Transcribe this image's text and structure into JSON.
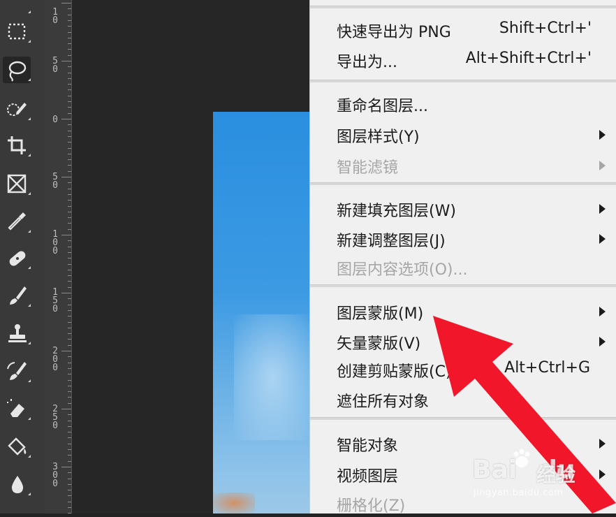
{
  "ruler": {
    "marks": [
      {
        "top": "1",
        "digits": [
          "0"
        ]
      },
      {
        "top": "5",
        "digits": [
          "0"
        ]
      },
      {
        "top": "0",
        "digits": []
      },
      {
        "top": "5",
        "digits": [
          "0"
        ]
      },
      {
        "top": "1",
        "digits": [
          "0",
          "0"
        ]
      },
      {
        "top": "1",
        "digits": [
          "5",
          "0"
        ]
      },
      {
        "top": "2",
        "digits": [
          "0",
          "0"
        ]
      },
      {
        "top": "2",
        "digits": [
          "5",
          "0"
        ]
      },
      {
        "top": "3",
        "digits": [
          "0",
          "0"
        ]
      }
    ]
  },
  "tools": [
    {
      "name": "move-tool",
      "icon": "move-icon"
    },
    {
      "name": "marquee-tool",
      "icon": "marquee-icon"
    },
    {
      "name": "lasso-tool",
      "icon": "lasso-icon",
      "active": true
    },
    {
      "name": "quick-selection-tool",
      "icon": "quick-selection-icon"
    },
    {
      "name": "crop-tool",
      "icon": "crop-icon"
    },
    {
      "name": "frame-tool",
      "icon": "frame-icon"
    },
    {
      "name": "eyedropper-tool",
      "icon": "eyedropper-icon"
    },
    {
      "name": "healing-tool",
      "icon": "bandage-icon"
    },
    {
      "name": "brush-tool",
      "icon": "brush-icon"
    },
    {
      "name": "stamp-tool",
      "icon": "stamp-icon"
    },
    {
      "name": "history-brush-tool",
      "icon": "history-brush-icon"
    },
    {
      "name": "eraser-tool",
      "icon": "eraser-icon"
    },
    {
      "name": "paint-bucket-tool",
      "icon": "paint-bucket-icon"
    },
    {
      "name": "blur-tool",
      "icon": "drop-icon"
    }
  ],
  "menu": {
    "items": [
      {
        "label": "快速导出为 PNG",
        "shortcut": "Shift+Ctrl+'"
      },
      {
        "label": "导出为...",
        "shortcut": "Alt+Shift+Ctrl+'"
      },
      {
        "label": "重命名图层..."
      },
      {
        "label": "图层样式(Y)",
        "submenu": true
      },
      {
        "label": "智能滤镜",
        "submenu": true,
        "disabled": true
      },
      {
        "label": "新建填充图层(W)",
        "submenu": true
      },
      {
        "label": "新建调整图层(J)",
        "submenu": true
      },
      {
        "label": "图层内容选项(O)...",
        "disabled": true
      },
      {
        "label": "图层蒙版(M)",
        "submenu": true
      },
      {
        "label": "矢量蒙版(V)",
        "submenu": true
      },
      {
        "label": "创建剪贴蒙版(C)",
        "shortcut": "Alt+Ctrl+G"
      },
      {
        "label": "遮住所有对象"
      },
      {
        "label": "智能对象",
        "submenu": true
      },
      {
        "label": "视频图层",
        "submenu": true
      },
      {
        "label": "栅格化(Z)",
        "submenu": true,
        "disabled": true
      }
    ]
  },
  "annotation": {
    "color": "#f2162a"
  },
  "watermark": {
    "logo_left": "Bai",
    "logo_right": "du",
    "sub": "经验",
    "url": "jingyan.baidu.com"
  }
}
